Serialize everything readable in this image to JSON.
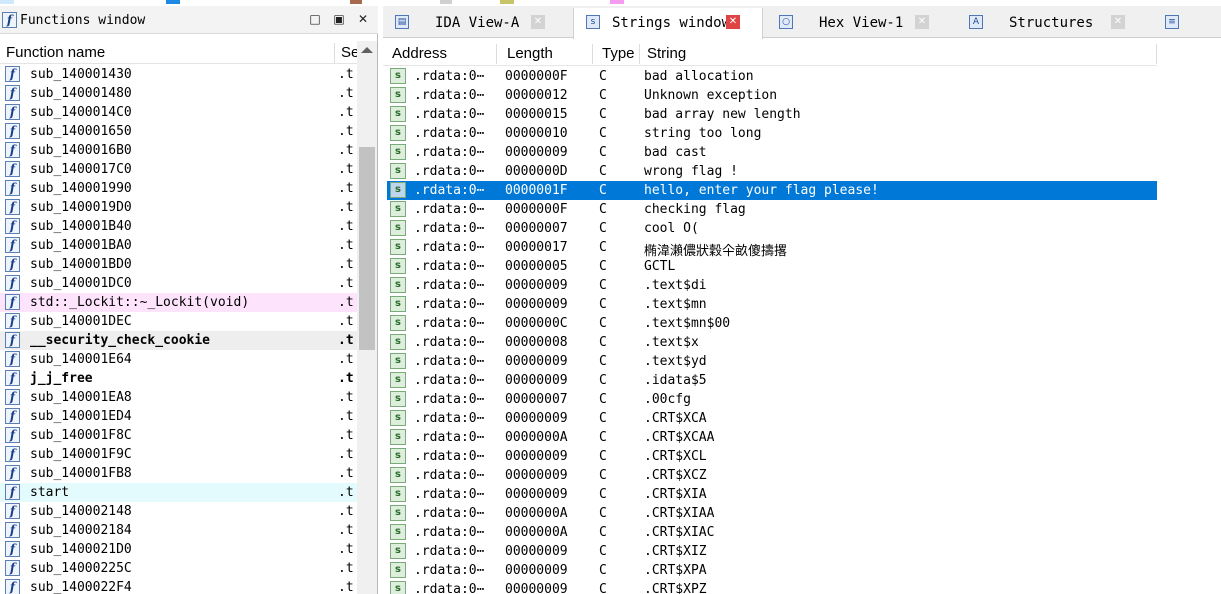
{
  "legend": {
    "colors": [
      "#cfe8fb",
      "#1e88e5",
      "#a86a4c",
      "#d0d0d0",
      "#c8c46a",
      "#f49cf0"
    ]
  },
  "functions_window": {
    "title": "Functions window",
    "minimize_glyph": "□",
    "float_glyph": "▣",
    "close_glyph": "✕",
    "header": {
      "name": "Function name",
      "segment": "Se"
    },
    "rows": [
      {
        "name": "sub_140001430",
        "segment": ".t",
        "style": ""
      },
      {
        "name": "sub_140001480",
        "segment": ".t",
        "style": ""
      },
      {
        "name": "sub_1400014C0",
        "segment": ".t",
        "style": ""
      },
      {
        "name": "sub_140001650",
        "segment": ".t",
        "style": ""
      },
      {
        "name": "sub_1400016B0",
        "segment": ".t",
        "style": ""
      },
      {
        "name": "sub_1400017C0",
        "segment": ".t",
        "style": ""
      },
      {
        "name": "sub_140001990",
        "segment": ".t",
        "style": ""
      },
      {
        "name": "sub_1400019D0",
        "segment": ".t",
        "style": ""
      },
      {
        "name": "sub_140001B40",
        "segment": ".t",
        "style": ""
      },
      {
        "name": "sub_140001BA0",
        "segment": ".t",
        "style": ""
      },
      {
        "name": "sub_140001BD0",
        "segment": ".t",
        "style": ""
      },
      {
        "name": "sub_140001DC0",
        "segment": ".t",
        "style": ""
      },
      {
        "name": "std::_Lockit::~_Lockit(void)",
        "segment": ".t",
        "style": "lib"
      },
      {
        "name": "sub_140001DEC",
        "segment": ".t",
        "style": ""
      },
      {
        "name": "__security_check_cookie",
        "segment": ".t",
        "style": "bold sel"
      },
      {
        "name": "sub_140001E64",
        "segment": ".t",
        "style": ""
      },
      {
        "name": "j_j_free",
        "segment": ".t",
        "style": "bold"
      },
      {
        "name": "sub_140001EA8",
        "segment": ".t",
        "style": ""
      },
      {
        "name": "sub_140001ED4",
        "segment": ".t",
        "style": ""
      },
      {
        "name": "sub_140001F8C",
        "segment": ".t",
        "style": ""
      },
      {
        "name": "sub_140001F9C",
        "segment": ".t",
        "style": ""
      },
      {
        "name": "sub_140001FB8",
        "segment": ".t",
        "style": ""
      },
      {
        "name": "start",
        "segment": ".t",
        "style": "entry"
      },
      {
        "name": "sub_140002148",
        "segment": ".t",
        "style": ""
      },
      {
        "name": "sub_140002184",
        "segment": ".t",
        "style": ""
      },
      {
        "name": "sub_1400021D0",
        "segment": ".t",
        "style": ""
      },
      {
        "name": "sub_14000225C",
        "segment": ".t",
        "style": ""
      },
      {
        "name": "sub_1400022F4",
        "segment": ".t",
        "style": ""
      }
    ]
  },
  "tabs": [
    {
      "label": "IDA View-A",
      "icon": "ida-view-icon",
      "glyph": "▤",
      "active": false
    },
    {
      "label": "Strings window",
      "icon": "strings-icon",
      "glyph": "s",
      "active": true
    },
    {
      "label": "Hex View-1",
      "icon": "hex-view-icon",
      "glyph": "○",
      "active": false
    },
    {
      "label": "Structures",
      "icon": "structures-icon",
      "glyph": "A",
      "active": false
    },
    {
      "label": "",
      "icon": "enums-icon",
      "glyph": "≡",
      "active": false
    }
  ],
  "tab_close_glyph": "✕",
  "strings_window": {
    "header": {
      "address": "Address",
      "length": "Length",
      "type": "Type",
      "string": "String"
    },
    "rows": [
      {
        "address": ".rdata:0⋯",
        "length": "0000000F",
        "type": "C",
        "string": "bad allocation"
      },
      {
        "address": ".rdata:0⋯",
        "length": "00000012",
        "type": "C",
        "string": "Unknown exception"
      },
      {
        "address": ".rdata:0⋯",
        "length": "00000015",
        "type": "C",
        "string": "bad array new length"
      },
      {
        "address": ".rdata:0⋯",
        "length": "00000010",
        "type": "C",
        "string": "string too long"
      },
      {
        "address": ".rdata:0⋯",
        "length": "00000009",
        "type": "C",
        "string": "bad cast"
      },
      {
        "address": ".rdata:0⋯",
        "length": "0000000D",
        "type": "C",
        "string": "wrong flag !"
      },
      {
        "address": ".rdata:0⋯",
        "length": "0000001F",
        "type": "C",
        "string": "hello, enter your flag please!",
        "selected": true
      },
      {
        "address": ".rdata:0⋯",
        "length": "0000000F",
        "type": "C",
        "string": "checking flag"
      },
      {
        "address": ".rdata:0⋯",
        "length": "00000007",
        "type": "C",
        "string": "cool O("
      },
      {
        "address": ".rdata:0⋯",
        "length": "00000017",
        "type": "C",
        "string": "椭湋瀨儂狀穀仐畝傻擣撂",
        "cjk": true
      },
      {
        "address": ".rdata:0⋯",
        "length": "00000005",
        "type": "C",
        "string": "GCTL"
      },
      {
        "address": ".rdata:0⋯",
        "length": "00000009",
        "type": "C",
        "string": ".text$di"
      },
      {
        "address": ".rdata:0⋯",
        "length": "00000009",
        "type": "C",
        "string": ".text$mn"
      },
      {
        "address": ".rdata:0⋯",
        "length": "0000000C",
        "type": "C",
        "string": ".text$mn$00"
      },
      {
        "address": ".rdata:0⋯",
        "length": "00000008",
        "type": "C",
        "string": ".text$x"
      },
      {
        "address": ".rdata:0⋯",
        "length": "00000009",
        "type": "C",
        "string": ".text$yd"
      },
      {
        "address": ".rdata:0⋯",
        "length": "00000009",
        "type": "C",
        "string": ".idata$5"
      },
      {
        "address": ".rdata:0⋯",
        "length": "00000007",
        "type": "C",
        "string": ".00cfg"
      },
      {
        "address": ".rdata:0⋯",
        "length": "00000009",
        "type": "C",
        "string": ".CRT$XCA"
      },
      {
        "address": ".rdata:0⋯",
        "length": "0000000A",
        "type": "C",
        "string": ".CRT$XCAA"
      },
      {
        "address": ".rdata:0⋯",
        "length": "00000009",
        "type": "C",
        "string": ".CRT$XCL"
      },
      {
        "address": ".rdata:0⋯",
        "length": "00000009",
        "type": "C",
        "string": ".CRT$XCZ"
      },
      {
        "address": ".rdata:0⋯",
        "length": "00000009",
        "type": "C",
        "string": ".CRT$XIA"
      },
      {
        "address": ".rdata:0⋯",
        "length": "0000000A",
        "type": "C",
        "string": ".CRT$XIAA"
      },
      {
        "address": ".rdata:0⋯",
        "length": "0000000A",
        "type": "C",
        "string": ".CRT$XIAC"
      },
      {
        "address": ".rdata:0⋯",
        "length": "00000009",
        "type": "C",
        "string": ".CRT$XIZ"
      },
      {
        "address": ".rdata:0⋯",
        "length": "00000009",
        "type": "C",
        "string": ".CRT$XPA"
      },
      {
        "address": ".rdata:0⋯",
        "length": "00000009",
        "type": "C",
        "string": ".CRT$XPZ"
      }
    ]
  }
}
